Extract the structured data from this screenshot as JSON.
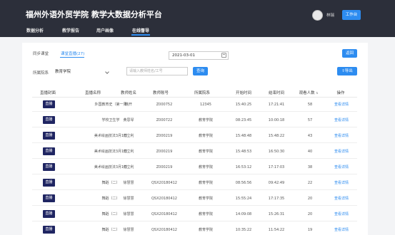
{
  "header": {
    "title": "福州外语外贸学院 教学大数据分析平台",
    "username": "林瑞",
    "workbench_label": "工作台"
  },
  "nav": {
    "items": [
      {
        "label": "数据分析"
      },
      {
        "label": "教学报告"
      },
      {
        "label": "用户画像"
      },
      {
        "label": "在线督导"
      }
    ],
    "active": "在线督导"
  },
  "tabs": {
    "items": [
      {
        "label": "同步课堂"
      },
      {
        "label": "课堂直播(27)"
      }
    ],
    "active": "课堂直播(27)"
  },
  "date_filter": {
    "value": "2021-03-01",
    "icon": "calendar-icon"
  },
  "back_button": {
    "label": "返回"
  },
  "filters": {
    "college_label": "所属院系",
    "college_value": "教育学院",
    "search_placeholder": "请输入教师姓名/工号",
    "query_label": "查询",
    "export_label": "导出"
  },
  "table": {
    "columns": [
      "直播封面",
      "直播名称",
      "教师姓名",
      "教师账号",
      "所属院系",
      "开始时间",
      "结束时间",
      "观看人数",
      "操作"
    ],
    "live_label": "直播",
    "action_label": "查看详情",
    "rows": [
      {
        "name": "外国教育史（第一周",
        "teacher": "韩开",
        "account": "Z000752",
        "college": "12345",
        "start": "15:40:25",
        "end": "17:21:41",
        "viewers": "58"
      },
      {
        "name": "学校卫生学",
        "teacher": "黄思琴",
        "account": "Z000722",
        "college": "教育学院",
        "start": "08:23:45",
        "end": "10:00:18",
        "viewers": "57"
      },
      {
        "name": "美术绘画技法3月1日",
        "teacher": "付立利",
        "account": "Z000219",
        "college": "教育学院",
        "start": "15:48:48",
        "end": "15:48:22",
        "viewers": "43"
      },
      {
        "name": "美术绘画技法3月1日",
        "teacher": "付立利",
        "account": "Z000219",
        "college": "教育学院",
        "start": "15:48:53",
        "end": "16:50:30",
        "viewers": "40"
      },
      {
        "name": "美术绘画技法3月1日",
        "teacher": "付立利",
        "account": "Z000219",
        "college": "教育学院",
        "start": "16:53:12",
        "end": "17:17:03",
        "viewers": "38"
      },
      {
        "name": "舞蹈（二）",
        "teacher": "徐慧慧",
        "account": "QSX20180412",
        "college": "教育学院",
        "start": "08:56:56",
        "end": "09:42:49",
        "viewers": "22"
      },
      {
        "name": "舞蹈（二）",
        "teacher": "徐慧慧",
        "account": "QSX20180412",
        "college": "教育学院",
        "start": "15:55:24",
        "end": "17:17:35",
        "viewers": "20"
      },
      {
        "name": "舞蹈（二）",
        "teacher": "徐慧慧",
        "account": "QSX20180412",
        "college": "教育学院",
        "start": "14:09:08",
        "end": "15:26:31",
        "viewers": "20"
      },
      {
        "name": "舞蹈（二）",
        "teacher": "徐慧慧",
        "account": "QSX20180412",
        "college": "教育学院",
        "start": "10:35:22",
        "end": "11:54:22",
        "viewers": "19"
      }
    ]
  }
}
